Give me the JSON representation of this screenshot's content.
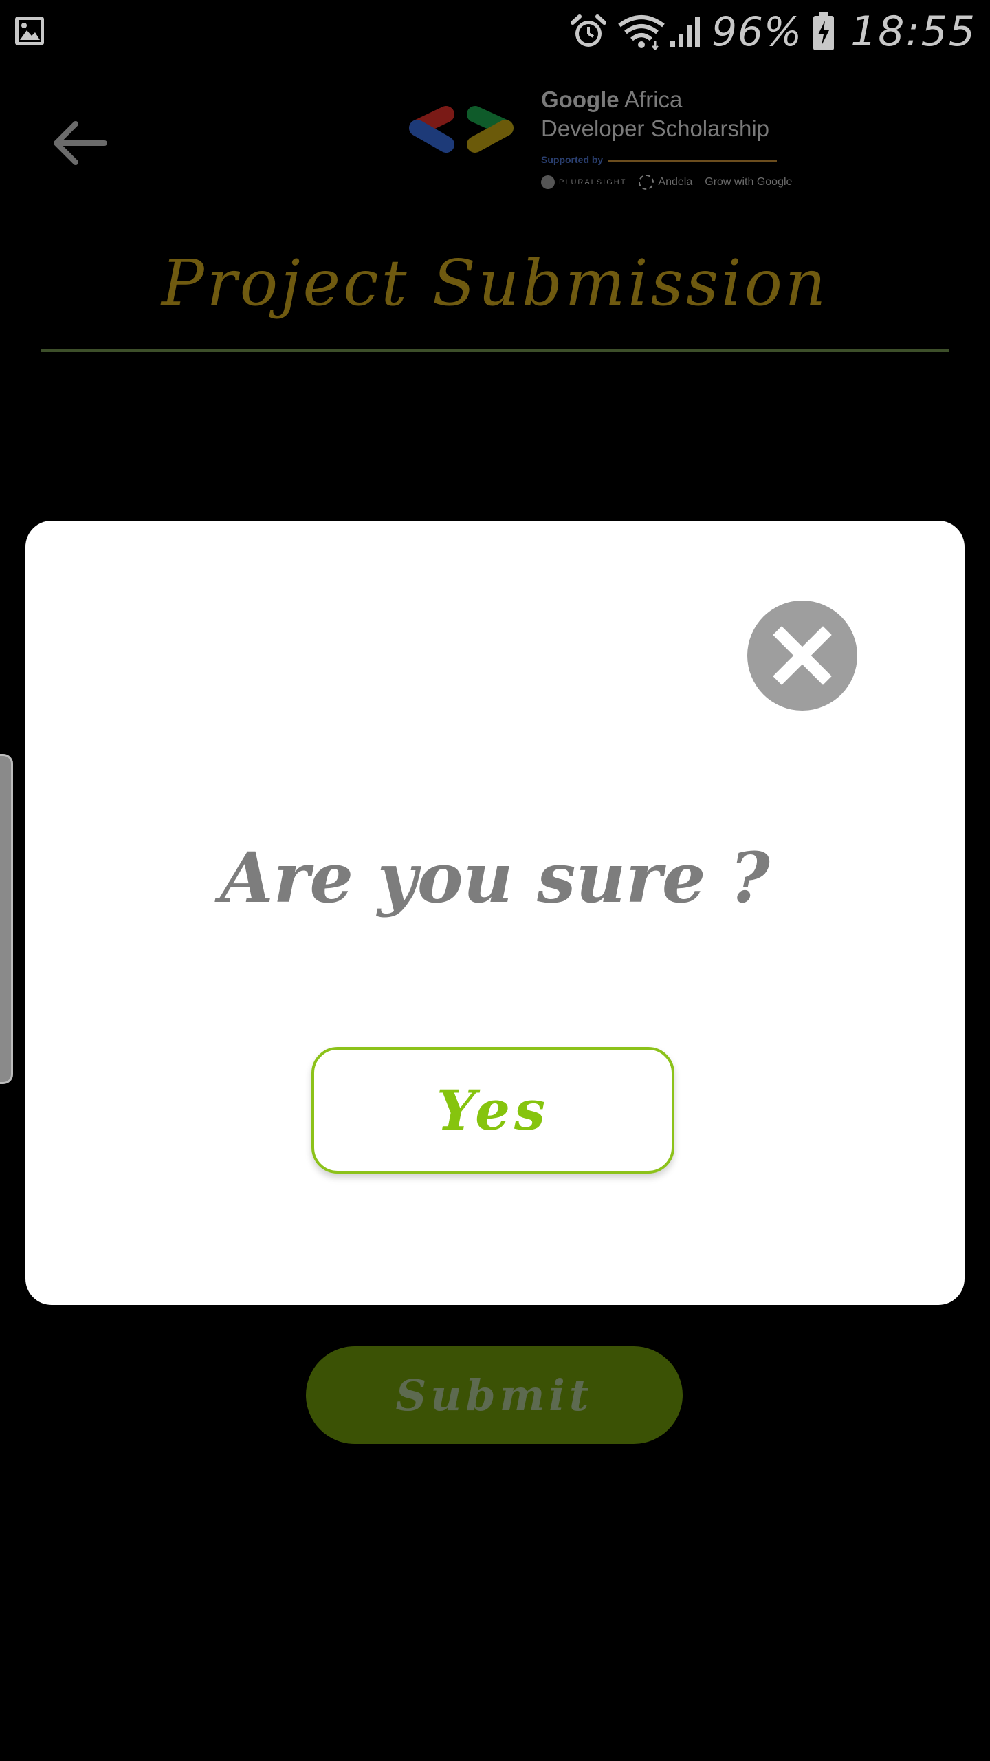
{
  "status_bar": {
    "battery": "96%",
    "time": "18:55",
    "icons": [
      "image-icon",
      "alarm-icon",
      "wifi-icon",
      "signal-icon",
      "battery-charging-icon"
    ]
  },
  "header": {
    "back_icon": "arrow-left-icon",
    "logo": {
      "title_bold": "Google",
      "title_rest": " Africa",
      "title_line2": "Developer Scholarship",
      "supported_by": "Supported by",
      "partners": [
        "PLURALSIGHT",
        "Andela",
        "Grow with Google"
      ]
    }
  },
  "page": {
    "title": "Project Submission",
    "submit_label": "Submit"
  },
  "dialog": {
    "question": "Are you sure ?",
    "yes_label": "Yes",
    "close_icon": "close-icon"
  },
  "colors": {
    "background": "#000000",
    "title": "#6f5a10",
    "divider": "#3d4f2a",
    "submit_bg": "#3b5205",
    "yes_accent": "#86c40e",
    "close_bg": "#9e9e9e",
    "question_text": "#7d7d7d"
  }
}
